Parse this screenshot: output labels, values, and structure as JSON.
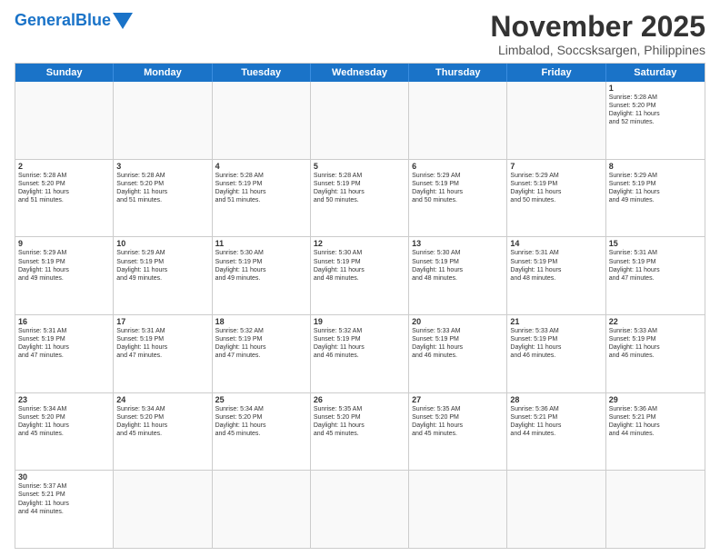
{
  "header": {
    "logo_general": "General",
    "logo_blue": "Blue",
    "month_year": "November 2025",
    "location": "Limbalod, Soccsksargen, Philippines"
  },
  "weekdays": [
    "Sunday",
    "Monday",
    "Tuesday",
    "Wednesday",
    "Thursday",
    "Friday",
    "Saturday"
  ],
  "rows": [
    [
      {
        "day": "",
        "text": ""
      },
      {
        "day": "",
        "text": ""
      },
      {
        "day": "",
        "text": ""
      },
      {
        "day": "",
        "text": ""
      },
      {
        "day": "",
        "text": ""
      },
      {
        "day": "",
        "text": ""
      },
      {
        "day": "1",
        "text": "Sunrise: 5:28 AM\nSunset: 5:20 PM\nDaylight: 11 hours\nand 52 minutes."
      }
    ],
    [
      {
        "day": "2",
        "text": "Sunrise: 5:28 AM\nSunset: 5:20 PM\nDaylight: 11 hours\nand 51 minutes."
      },
      {
        "day": "3",
        "text": "Sunrise: 5:28 AM\nSunset: 5:20 PM\nDaylight: 11 hours\nand 51 minutes."
      },
      {
        "day": "4",
        "text": "Sunrise: 5:28 AM\nSunset: 5:19 PM\nDaylight: 11 hours\nand 51 minutes."
      },
      {
        "day": "5",
        "text": "Sunrise: 5:28 AM\nSunset: 5:19 PM\nDaylight: 11 hours\nand 50 minutes."
      },
      {
        "day": "6",
        "text": "Sunrise: 5:29 AM\nSunset: 5:19 PM\nDaylight: 11 hours\nand 50 minutes."
      },
      {
        "day": "7",
        "text": "Sunrise: 5:29 AM\nSunset: 5:19 PM\nDaylight: 11 hours\nand 50 minutes."
      },
      {
        "day": "8",
        "text": "Sunrise: 5:29 AM\nSunset: 5:19 PM\nDaylight: 11 hours\nand 49 minutes."
      }
    ],
    [
      {
        "day": "9",
        "text": "Sunrise: 5:29 AM\nSunset: 5:19 PM\nDaylight: 11 hours\nand 49 minutes."
      },
      {
        "day": "10",
        "text": "Sunrise: 5:29 AM\nSunset: 5:19 PM\nDaylight: 11 hours\nand 49 minutes."
      },
      {
        "day": "11",
        "text": "Sunrise: 5:30 AM\nSunset: 5:19 PM\nDaylight: 11 hours\nand 49 minutes."
      },
      {
        "day": "12",
        "text": "Sunrise: 5:30 AM\nSunset: 5:19 PM\nDaylight: 11 hours\nand 48 minutes."
      },
      {
        "day": "13",
        "text": "Sunrise: 5:30 AM\nSunset: 5:19 PM\nDaylight: 11 hours\nand 48 minutes."
      },
      {
        "day": "14",
        "text": "Sunrise: 5:31 AM\nSunset: 5:19 PM\nDaylight: 11 hours\nand 48 minutes."
      },
      {
        "day": "15",
        "text": "Sunrise: 5:31 AM\nSunset: 5:19 PM\nDaylight: 11 hours\nand 47 minutes."
      }
    ],
    [
      {
        "day": "16",
        "text": "Sunrise: 5:31 AM\nSunset: 5:19 PM\nDaylight: 11 hours\nand 47 minutes."
      },
      {
        "day": "17",
        "text": "Sunrise: 5:31 AM\nSunset: 5:19 PM\nDaylight: 11 hours\nand 47 minutes."
      },
      {
        "day": "18",
        "text": "Sunrise: 5:32 AM\nSunset: 5:19 PM\nDaylight: 11 hours\nand 47 minutes."
      },
      {
        "day": "19",
        "text": "Sunrise: 5:32 AM\nSunset: 5:19 PM\nDaylight: 11 hours\nand 46 minutes."
      },
      {
        "day": "20",
        "text": "Sunrise: 5:33 AM\nSunset: 5:19 PM\nDaylight: 11 hours\nand 46 minutes."
      },
      {
        "day": "21",
        "text": "Sunrise: 5:33 AM\nSunset: 5:19 PM\nDaylight: 11 hours\nand 46 minutes."
      },
      {
        "day": "22",
        "text": "Sunrise: 5:33 AM\nSunset: 5:19 PM\nDaylight: 11 hours\nand 46 minutes."
      }
    ],
    [
      {
        "day": "23",
        "text": "Sunrise: 5:34 AM\nSunset: 5:20 PM\nDaylight: 11 hours\nand 45 minutes."
      },
      {
        "day": "24",
        "text": "Sunrise: 5:34 AM\nSunset: 5:20 PM\nDaylight: 11 hours\nand 45 minutes."
      },
      {
        "day": "25",
        "text": "Sunrise: 5:34 AM\nSunset: 5:20 PM\nDaylight: 11 hours\nand 45 minutes."
      },
      {
        "day": "26",
        "text": "Sunrise: 5:35 AM\nSunset: 5:20 PM\nDaylight: 11 hours\nand 45 minutes."
      },
      {
        "day": "27",
        "text": "Sunrise: 5:35 AM\nSunset: 5:20 PM\nDaylight: 11 hours\nand 45 minutes."
      },
      {
        "day": "28",
        "text": "Sunrise: 5:36 AM\nSunset: 5:21 PM\nDaylight: 11 hours\nand 44 minutes."
      },
      {
        "day": "29",
        "text": "Sunrise: 5:36 AM\nSunset: 5:21 PM\nDaylight: 11 hours\nand 44 minutes."
      }
    ],
    [
      {
        "day": "30",
        "text": "Sunrise: 5:37 AM\nSunset: 5:21 PM\nDaylight: 11 hours\nand 44 minutes."
      },
      {
        "day": "",
        "text": ""
      },
      {
        "day": "",
        "text": ""
      },
      {
        "day": "",
        "text": ""
      },
      {
        "day": "",
        "text": ""
      },
      {
        "day": "",
        "text": ""
      },
      {
        "day": "",
        "text": ""
      }
    ]
  ]
}
